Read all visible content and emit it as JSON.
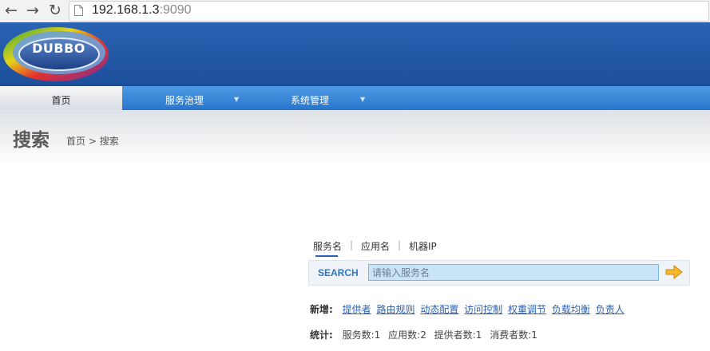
{
  "browser": {
    "back_icon": "arrow-left-icon",
    "forward_icon": "arrow-right-icon",
    "reload_icon": "reload-icon",
    "url_host": "192.168.1.3",
    "url_port": ":9090"
  },
  "banner": {
    "logo_text": "DUBBO"
  },
  "menu": {
    "items": [
      {
        "label": "首页"
      },
      {
        "label": "服务治理"
      },
      {
        "label": "系统管理"
      }
    ],
    "dropdown_arrow": "▼"
  },
  "header": {
    "title": "搜索",
    "breadcrumb_home": "首页",
    "breadcrumb_sep": " > ",
    "breadcrumb_current": "搜索"
  },
  "search": {
    "tabs": [
      {
        "label": "服务名"
      },
      {
        "label": "应用名"
      },
      {
        "label": "机器IP"
      }
    ],
    "tab_separator": "|",
    "label": "SEARCH",
    "placeholder": "请输入服务名",
    "value": ""
  },
  "add": {
    "label": "新增:",
    "links": [
      "提供者",
      "路由规则",
      "动态配置",
      "访问控制",
      "权重调节",
      "负载均衡",
      "负责人"
    ]
  },
  "stats": {
    "label": "统计:",
    "items": [
      "服务数:1",
      "应用数:2",
      "提供者数:1",
      "消费者数:1"
    ]
  },
  "colors": {
    "banner": "#2a63b3",
    "menubar": "#2876cc",
    "link": "#2a5fb0",
    "search_label": "#2e77c4"
  }
}
